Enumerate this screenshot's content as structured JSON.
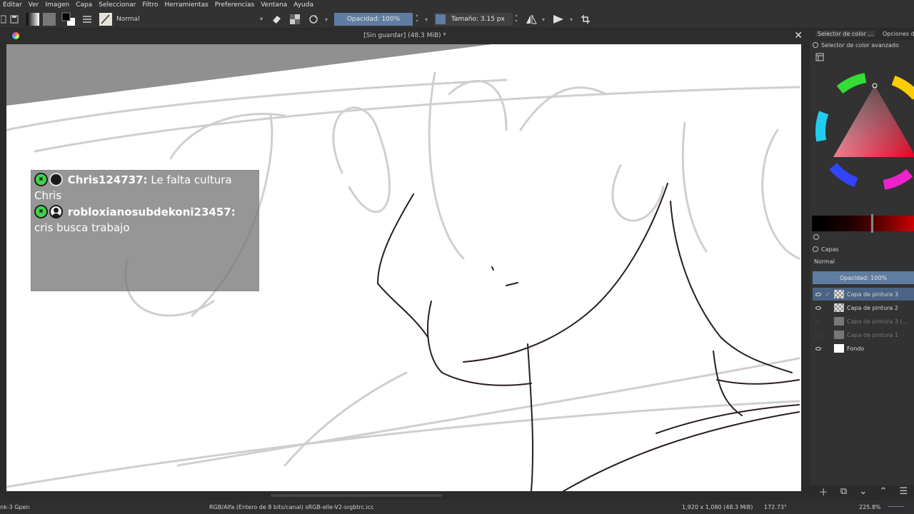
{
  "menubar": {
    "items": [
      "Editar",
      "Ver",
      "Imagen",
      "Capa",
      "Seleccionar",
      "Filtro",
      "Herramientas",
      "Preferencias",
      "Ventana",
      "Ayuda"
    ]
  },
  "toolbar": {
    "blend_mode": "Normal",
    "opacity_label": "Opacidad: 100%",
    "size_label": "Tamaño: 3.15 px"
  },
  "document": {
    "title": "[Sin guardar]  (48.3 MiB) *",
    "close_glyph": "✕"
  },
  "chat": {
    "messages": [
      {
        "user": "Chris124737:",
        "text": " Le falta cultura Chris"
      },
      {
        "user": "robloxianosubdekoni23457:",
        "text": " cris busca trabajo"
      }
    ]
  },
  "dock": {
    "tab_color": "Selector de color ...",
    "tab_options": "Opciones de",
    "color_panel_title": "Selector de color avanzado",
    "layers_title": "Capas",
    "layers_blend": "Normal",
    "layers_opacity": "Opacidad:  100%",
    "layers": [
      {
        "name": "Capa de pintura 3",
        "selected": true,
        "visible": true
      },
      {
        "name": "Capa de pintura 2",
        "selected": false,
        "visible": true
      },
      {
        "name": "Capa de pintura 3 (...",
        "selected": false,
        "visible": false
      },
      {
        "name": "Capa de pintura 1",
        "selected": false,
        "visible": false
      },
      {
        "name": "Fondo",
        "selected": false,
        "visible": true
      }
    ]
  },
  "status": {
    "brush": "nk-3 Gpen",
    "color_profile": "RGB/Alfa (Entero de 8 bits/canal)  sRGB-elle-V2-srgbtrc.icc",
    "dimensions": "1,920 x 1,080 (48.3 MiB)",
    "rotation": "172.73°",
    "zoom": "225.8%"
  },
  "colors": {
    "accent": "#5f7da0",
    "chat_badge": "#3fd34a"
  }
}
